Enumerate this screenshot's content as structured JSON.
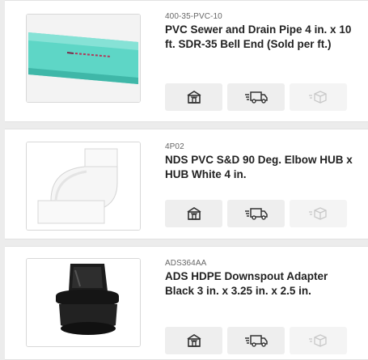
{
  "products": [
    {
      "sku": "400-35-PVC-10",
      "title": "PVC Sewer and Drain Pipe 4 in. x 10 ft. SDR-35 Bell End (Sold per ft.)",
      "image_icon": "green-pipe",
      "actions": [
        {
          "icon": "store-icon",
          "enabled": true
        },
        {
          "icon": "delivery-truck-icon",
          "enabled": true
        },
        {
          "icon": "box-icon",
          "enabled": false
        }
      ]
    },
    {
      "sku": "4P02",
      "title": "NDS PVC S&D 90 Deg. Elbow HUB x HUB White 4 in.",
      "image_icon": "white-elbow-fitting",
      "actions": [
        {
          "icon": "store-icon",
          "enabled": true
        },
        {
          "icon": "delivery-truck-icon",
          "enabled": true
        },
        {
          "icon": "box-icon",
          "enabled": false
        }
      ]
    },
    {
      "sku": "ADS364AA",
      "title": "ADS HDPE Downspout Adapter Black 3 in. x 3.25 in. x 2.5 in.",
      "image_icon": "black-downspout-adapter",
      "actions": [
        {
          "icon": "store-icon",
          "enabled": true
        },
        {
          "icon": "delivery-truck-icon",
          "enabled": true
        },
        {
          "icon": "box-icon",
          "enabled": false
        }
      ]
    }
  ],
  "colors": {
    "page_bg": "#ececec",
    "card_bg": "#ffffff",
    "button_bg": "#eeeeee",
    "icon": "#333333",
    "icon_disabled": "#c8c8c8",
    "pipe": "#5ed6c6"
  }
}
